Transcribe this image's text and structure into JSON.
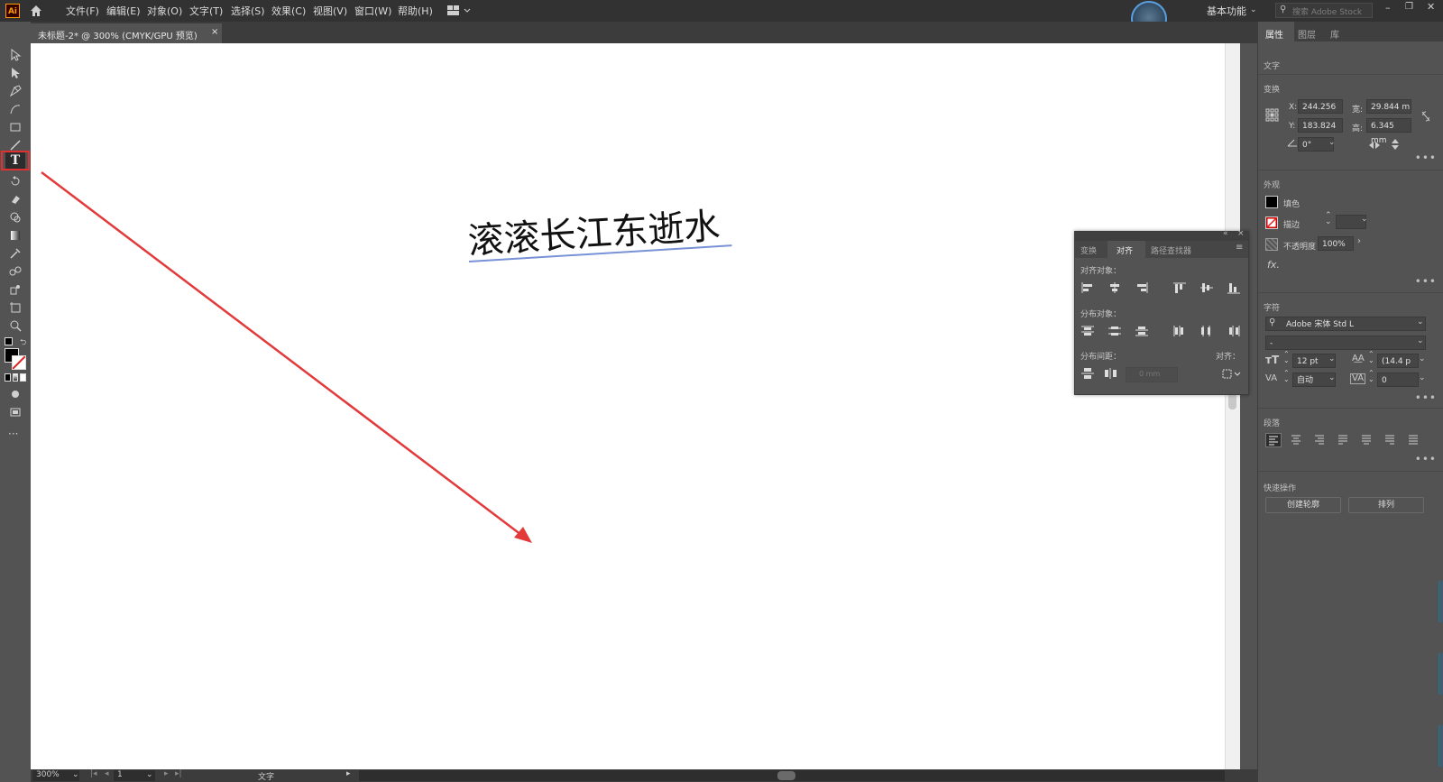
{
  "app": {
    "logo": "Ai"
  },
  "menubar": {
    "items": [
      "文件(F)",
      "编辑(E)",
      "对象(O)",
      "文字(T)",
      "选择(S)",
      "效果(C)",
      "视图(V)",
      "窗口(W)",
      "帮助(H)"
    ],
    "workspace": "基本功能",
    "search_placeholder": "搜索 Adobe Stock"
  },
  "tab": {
    "title": "未标题-2* @ 300% (CMYK/GPU 预览)",
    "close": "×"
  },
  "canvas": {
    "text": "滚滚长江东逝水"
  },
  "status": {
    "zoom": "300%",
    "page": "1",
    "tool": "文字"
  },
  "align_panel": {
    "tabs": [
      "变换",
      "对齐",
      "路径查找器"
    ],
    "align_objects_label": "对齐对象：",
    "distribute_objects_label": "分布对象：",
    "distribute_spacing_label": "分布间距：",
    "align_to_label": "对齐：",
    "spacing_value": "0 mm"
  },
  "properties": {
    "tabs": [
      "属性",
      "图层",
      "库"
    ],
    "selection_type": "文字",
    "transform": {
      "title": "变换",
      "x_label": "X:",
      "x": "244.256",
      "y_label": "Y:",
      "y": "183.824",
      "w_label": "宽:",
      "w": "29.844 m",
      "h_label": "高:",
      "h": "6.345 mm",
      "angle": "0°"
    },
    "appearance": {
      "title": "外观",
      "fill_label": "填色",
      "stroke_label": "描边",
      "opacity_label": "不透明度",
      "opacity": "100%",
      "fx": "fx."
    },
    "character": {
      "title": "字符",
      "font": "Adobe 宋体 Std L",
      "style": "-",
      "size": "12 pt",
      "leading": "(14.4 p",
      "tracking": "自动",
      "kerning": "0"
    },
    "paragraph": {
      "title": "段落"
    },
    "quick_actions": {
      "title": "快速操作",
      "create_outlines": "创建轮廓",
      "arrange": "排列"
    }
  }
}
